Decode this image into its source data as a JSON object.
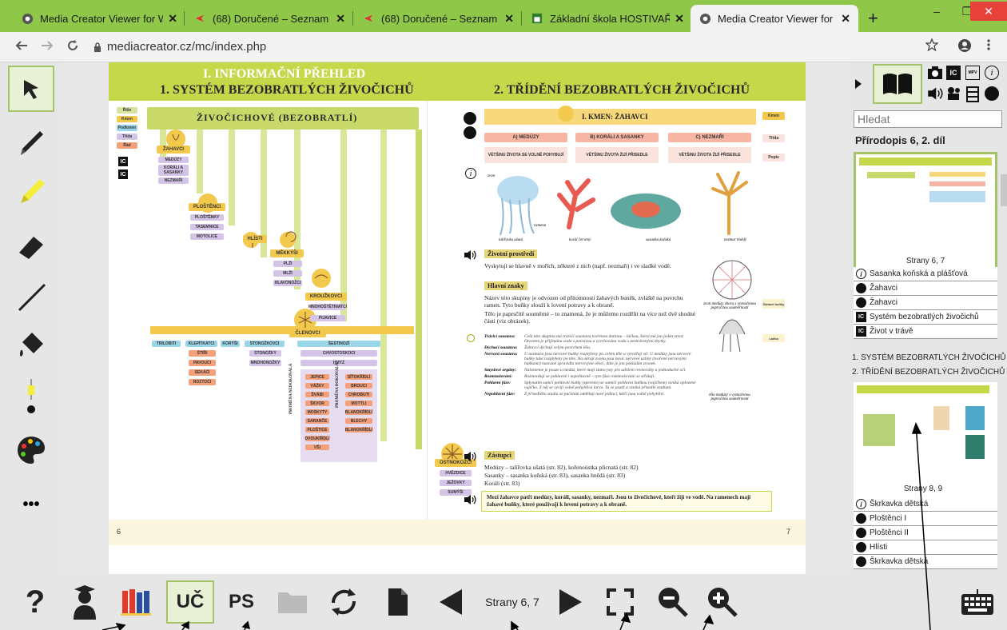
{
  "browser": {
    "tabs": [
      {
        "label": "Media Creator Viewer for We",
        "icon": "globe-icon"
      },
      {
        "label": "(68) Doručené – Seznam Ema",
        "icon": "seznam-icon"
      },
      {
        "label": "(68) Doručené – Seznam Ema",
        "icon": "seznam-icon"
      },
      {
        "label": "Základní škola HOSTIVAŘ",
        "icon": "school-icon"
      },
      {
        "label": "Media Creator Viewer for We",
        "icon": "globe-icon",
        "active": true
      }
    ],
    "url": "mediacreator.cz/mc/index.php",
    "tab_close": "✕",
    "new_tab": "+",
    "win_min": "–",
    "win_max": "❐",
    "win_close": "✕"
  },
  "left_tools": [
    "pointer-tool",
    "pen-tool",
    "highlighter-tool",
    "eraser-tool",
    "line-tool",
    "fill-tool",
    "size-slider",
    "color-palette",
    "more"
  ],
  "book": {
    "header_main": "I. INFORMAČNÍ PŘEHLED",
    "left_title": "1. SYSTÉM BEZOBRATLÝCH ŽIVOČICHŮ",
    "right_title": "2. TŘÍDĚNÍ BEZOBRATLÝCH ŽIVOČICHŮ",
    "left_page_num": "6",
    "right_page_num": "7",
    "tree_title": "ŽIVOČICHOVÉ (BEZOBRATLÍ)",
    "legend": [
      "Říše",
      "Kmen",
      "Podkmen",
      "Třída",
      "Řád"
    ],
    "groups": {
      "zahavci": "ŽAHAVCI",
      "plostenci": "PLOŠTĚNCI",
      "hlisti": "HLÍSTI",
      "mekkysi": "MĚKKÝŠI",
      "krouzkovci": "KROUŽKOVCI",
      "clenovci": "ČLENOVCI",
      "ostnokozci": "OSTNOKOŽCI"
    },
    "zahavci_items": [
      "MEDÚZY",
      "KORÁLI A SASANKY",
      "NEZMAŘI"
    ],
    "plostenci_items": [
      "PLOŠTĚNKY",
      "TASEMNICE",
      "MOTOLICE"
    ],
    "mekkysi_items": [
      "PLŽI",
      "MLŽI",
      "HLAVONOŽCI"
    ],
    "krouzkovci_items": [
      "MNOHOŠTĚTINATCI",
      "PIJAVICE"
    ],
    "clenovci_cols": [
      "TRILOBITI",
      "KLEPÍTKATCI",
      "KORÝŠI",
      "STONOŽKOVCI",
      "ŠESTINOZÍ"
    ],
    "klepitkatci_items": [
      "ŠTÍŘI",
      "PAVOUCI",
      "SEKÁČI",
      "ROZTOČI"
    ],
    "stonozkovci_items": [
      "STONOŽKY",
      "MNOHONOŽKY"
    ],
    "sestinozi_items": [
      "CHVOSTOSKOCI",
      "HMYZ"
    ],
    "hmyz_left": [
      "JEPICE",
      "VÁŽKY",
      "ŠVÁBI",
      "ŠKVOR",
      "MOSKYTY",
      "SARANČE",
      "PLOŠTICE",
      "DVOUKŘÍDLÍ",
      "VŠI"
    ],
    "hmyz_right": [
      "SÍŤOKŘÍDLÍ",
      "BROUCI",
      "CHROBUTI",
      "MOTÝLI",
      "BLANOKŘÍDLÍ",
      "BLECHY",
      "BLANOKŘÍDLÍ"
    ],
    "vertical_left": "PROMĚNA NEDOKONALÁ",
    "vertical_right": "PROMĚNA DOKONALÁ",
    "ostnokozci_items": [
      "HVĚZDICE",
      "JEŽOVKY",
      "SUMÝŠI"
    ],
    "right_kmen": "I. KMEN: ŽAHAVCI",
    "classes": [
      "A) MEDÚZY",
      "B) KORÁLI A SASANKY",
      "C) NEZMAŘI"
    ],
    "class_desc": [
      "VĚTŠINU ŽIVOTA SE VOLNĚ POHYBUJÍ",
      "VĚTŠINU ŽIVOTA ŽIJÍ PŘISEDLE",
      "VĚTŠINU ŽIVOTA ŽIJÍ PŘISEDLE"
    ],
    "right_legend": [
      "Kmen",
      "Třída",
      "Popis"
    ],
    "image_captions": [
      "talířovka ušatá",
      "korál červený",
      "sasanka koňská",
      "nezmar hnědý"
    ],
    "image_labels": [
      "zvon",
      "ramena"
    ],
    "sec_env": "Životní prostředí",
    "env_text": "Vyskytují se hlavně v mořích, některé z nich (např. nezmaři) i ve sladké vodě.",
    "sec_main": "Hlavní znaky",
    "main_text1": "Název této skupiny je odvozen od přítomnosti žahavých buněk, zvláště na povrchu ramen. Tyto buňky slouží k lovení potravy a k obraně.",
    "main_text2": "Tělo je paprsčitě souměrné – to znamená, že je můžeme rozdělit na více než dvě shodné části (viz obrázek).",
    "diag_caption1": "zvon medúzy shora s vyznačenou paprsčitou souměrností",
    "diag_caption2": "tělo medúzy s vyznačenou paprsčitou souměrností",
    "side_notes": [
      "Žahavé buňky",
      "Láčka"
    ],
    "systems": [
      {
        "name": "Trávicí soustava:",
        "text": "Celá tato skupina má trávicí soustavu tvořenou dutinou – láčkou, která má jen jeden otvor. Otvorem je přijímána voda s potravou a vyvrhována voda s nestrávenými zbytky."
      },
      {
        "name": "Dýchací soustava:",
        "text": "Žahavci dýchají celým povrchem těla."
      },
      {
        "name": "Nervová soustava:",
        "text": "U nezmara jsou nervové buňky rozptýleny po celém těle a vytvářejí síť. U medúzy jsou nervové buňky také rozptýleny po těle. Na okraji zvonu jsou navíc nervové uzliny (tvořené nervovými buňkami) nazvané zpravidla nervovými věnci, dále je jim pokládán zvonek."
      },
      {
        "name": "Smyslové orgány:",
        "text": "Nalezneme je pouze u medúz, které mají statocysty pro udržení rovnováhy a jednoduché oči."
      },
      {
        "name": "Rozmnožování:",
        "text": "Rozmnožují se pohlavně i nepohlavně – tyto fáze rozmnožování se střídají."
      },
      {
        "name": "Pohlavní fáze:",
        "text": "Splynutím samčí pohlavní buňky (spermie) se samičí pohlavní buňkou (vajíčkem) vzniká oplozené vajíčko. Z něj se vyvíjí volně pohyblivá larva. Ta se usadí a vzniká přisedlé stadium."
      },
      {
        "name": "Nepohlavní fáze:",
        "text": "Z přisedlého stadia se pučením oddělují nové jedinci, kteří jsou volně pohybliví."
      }
    ],
    "sec_rep": "Zástupci",
    "rep_lines": [
      "Medúzy – talířovka ušatá (str. 82), kořenoústka plicnatá (str. 82)",
      "Sasanky – sasanka koňská (str. 83), sasanka hnědá (str. 83)",
      "Koráli (str. 83)"
    ],
    "summary": "Mezi žahavce patří medúzy, koráli, sasanky, nezmaři. Jsou to živočichové, kteří žijí ve vodě. Na ramenech mají žahavé buňky, které používají k lovení potravy a k obraně."
  },
  "right_panel": {
    "search_placeholder": "Hledat",
    "book_title": "Přírodopis 6, 2. díl",
    "thumb1_label": "Strany 6, 7",
    "thumb1_items": [
      {
        "icon": "italic-info",
        "label": "Sasanka koňská a plášťová"
      },
      {
        "icon": "black-circle",
        "label": "Žahavci"
      },
      {
        "icon": "black-circle",
        "label": "Žahavci"
      },
      {
        "icon": "ic",
        "label": "Systém bezobratlých živočichů"
      },
      {
        "icon": "ic",
        "label": "Život v trávě"
      }
    ],
    "headings": [
      "1. SYSTÉM BEZOBRATLÝCH ŽIVOČICHŮ",
      "2. TŘÍDĚNÍ BEZOBRATLÝCH ŽIVOČICHŮ"
    ],
    "thumb2_label": "Strany 8, 9",
    "thumb2_items": [
      {
        "icon": "italic-info",
        "label": "Škrkavka dětská"
      },
      {
        "icon": "black-circle",
        "label": "Ploštěnci I"
      },
      {
        "icon": "black-circle",
        "label": "Ploštěnci II"
      },
      {
        "icon": "black-circle",
        "label": "Hlísti"
      },
      {
        "icon": "black-circle",
        "label": "Škrkavka dětská"
      }
    ],
    "filter_icons": [
      "camera-icon",
      "ic-icon",
      "mpv-icon",
      "info-icon",
      "sound-icon",
      "video-icon",
      "frame-icon",
      "globe-icon"
    ]
  },
  "bottom": {
    "help": "?",
    "uc": "UČ",
    "ps": "PS",
    "pages": "Strany 6, 7"
  },
  "ic_label": "IC",
  "mpv_label": "MPV",
  "info_glyph": "i",
  "dots": "•••",
  "colors": {
    "accent_green": "#8fc748",
    "header_green": "#c4d84a",
    "selected_border": "#a4c36a"
  }
}
